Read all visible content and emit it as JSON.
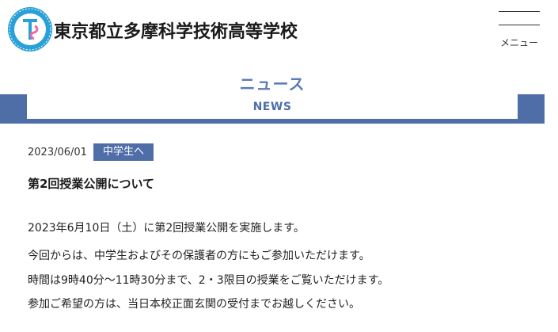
{
  "header": {
    "school_name": "東京都立多摩科学技術高等学校",
    "menu_label": "メニュー"
  },
  "section": {
    "title_ja": "ニュース",
    "title_en": "NEWS"
  },
  "article": {
    "date": "2023/06/01",
    "category": "中学生へ",
    "title": "第2回授業公開について",
    "body": [
      "2023年6月10日（土）に第2回授業公開を実施します。",
      "今回からは、中学生およびその保護者の方にもご参加いただけます。",
      "時間は9時40分～11時30分まで、2・3限目の授業をご覧いただけます。",
      "参加ご希望の方は、当日本校正面玄関の受付までお越しください。"
    ]
  },
  "colors": {
    "accent": "#4f6ea8",
    "title_blue": "#5b7bb5",
    "logo_blue": "#2aa0d8",
    "logo_pink": "#e86aa8"
  }
}
